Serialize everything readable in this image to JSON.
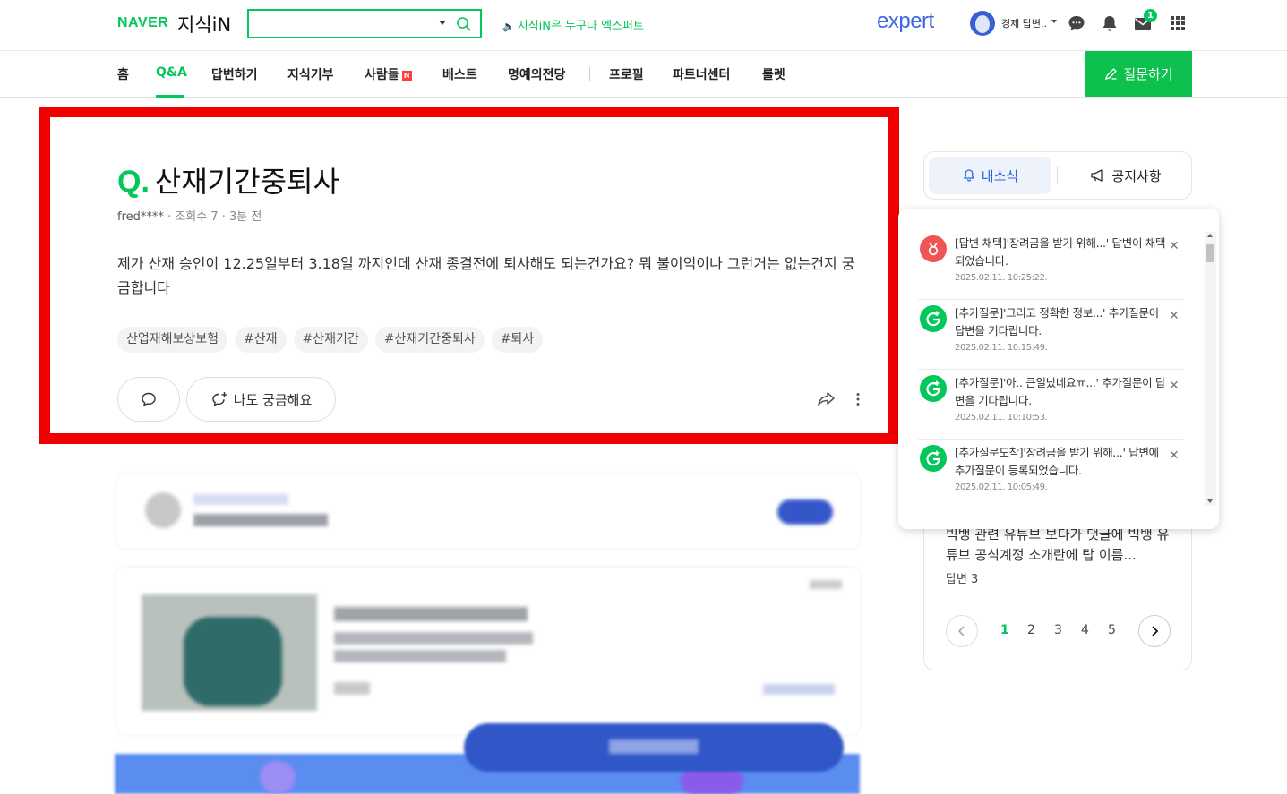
{
  "header": {
    "naver": "NAVER",
    "jisik": "지식iN",
    "search_value": "",
    "notice": "지식iN은 누구나 엑스퍼트",
    "expert": "expert",
    "user_name": "경제 답변..",
    "mail_count": "1"
  },
  "nav": {
    "items": [
      "홈",
      "Q&A",
      "답변하기",
      "지식기부",
      "사람들",
      "베스트",
      "명예의전당",
      "프로필",
      "파트너센터",
      "룰렛"
    ],
    "new_badge": "N",
    "ask_button": "질문하기"
  },
  "question": {
    "q_mark": "Q.",
    "title": "산재기간중퇴사",
    "author": "fred****",
    "views": "조회수 7",
    "time": "3분 전",
    "body": "제가 산재 승인이 12.25일부터 3.18일 까지인데 산재 종결전에 퇴사해도 되는건가요? 뭐 불이익이나 그런거는 없는건지 궁금합니다",
    "tags": [
      "산업재해보상보험",
      "#산재",
      "#산재기간",
      "#산재기간중퇴사",
      "#퇴사"
    ],
    "curious_label": "나도 궁금해요"
  },
  "right_panel": {
    "tab_news": "내소식",
    "tab_notice": "공지사항",
    "lower_text": "빅뱅 관련 유튜브 보다가 댓글에 빅뱅 유튜브 공식계정 소개란에 탑 이름...",
    "answer_count": "답변 3",
    "pages": [
      "1",
      "2",
      "3",
      "4",
      "5"
    ]
  },
  "notifications": [
    {
      "icon": "medal-icon",
      "color": "#f05454",
      "text": "[답변 채택]'장려금을 받기 위해...' 답변이 채택되었습니다.",
      "time": "2025.02.11. 10:25:22."
    },
    {
      "icon": "add-question-icon",
      "color": "#03c75a",
      "text": "[추가질문]'그리고 정확한 정보...' 추가질문이 답변을 기다립니다.",
      "time": "2025.02.11. 10:15:49."
    },
    {
      "icon": "add-question-icon",
      "color": "#03c75a",
      "text": "[추가질문]'아.. 큰일났네요ㅠ...' 추가질문이 답변을 기다립니다.",
      "time": "2025.02.11. 10:10:53."
    },
    {
      "icon": "add-question-icon",
      "color": "#03c75a",
      "text": "[추가질문도착]'장려금을 받기 위해...' 답변에 추가질문이 등록되었습니다.",
      "time": "2025.02.11. 10:05:49."
    }
  ]
}
